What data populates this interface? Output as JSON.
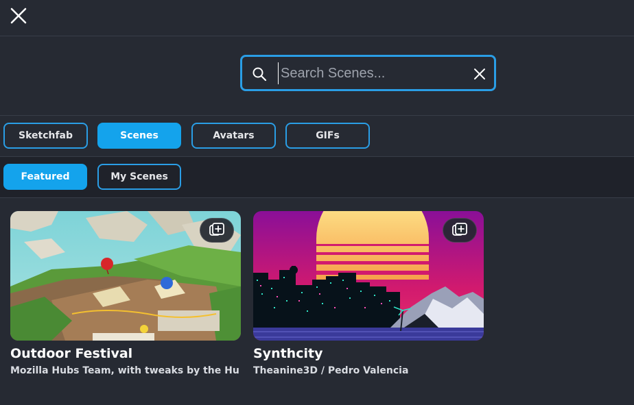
{
  "search": {
    "placeholder": "Search Scenes..."
  },
  "source_tabs": [
    {
      "label": "Sketchfab",
      "active": false
    },
    {
      "label": "Scenes",
      "active": true
    },
    {
      "label": "Avatars",
      "active": false
    },
    {
      "label": "GIFs",
      "active": false
    }
  ],
  "filter_tabs": [
    {
      "label": "Featured",
      "active": true
    },
    {
      "label": "My Scenes",
      "active": false
    }
  ],
  "results": [
    {
      "title": "Outdoor Festival",
      "attribution": "Mozilla Hubs Team, with tweaks by the Hu",
      "thumbnail": "outdoor-festival-thumbnail",
      "action_icon": "add-to-room-icon"
    },
    {
      "title": "Synthcity",
      "attribution": "Theanine3D / Pedro Valencia",
      "thumbnail": "synthcity-thumbnail",
      "action_icon": "add-to-room-icon"
    }
  ],
  "colors": {
    "accent": "#14a3ec",
    "background": "#262a33",
    "border": "#2a9ee6"
  }
}
